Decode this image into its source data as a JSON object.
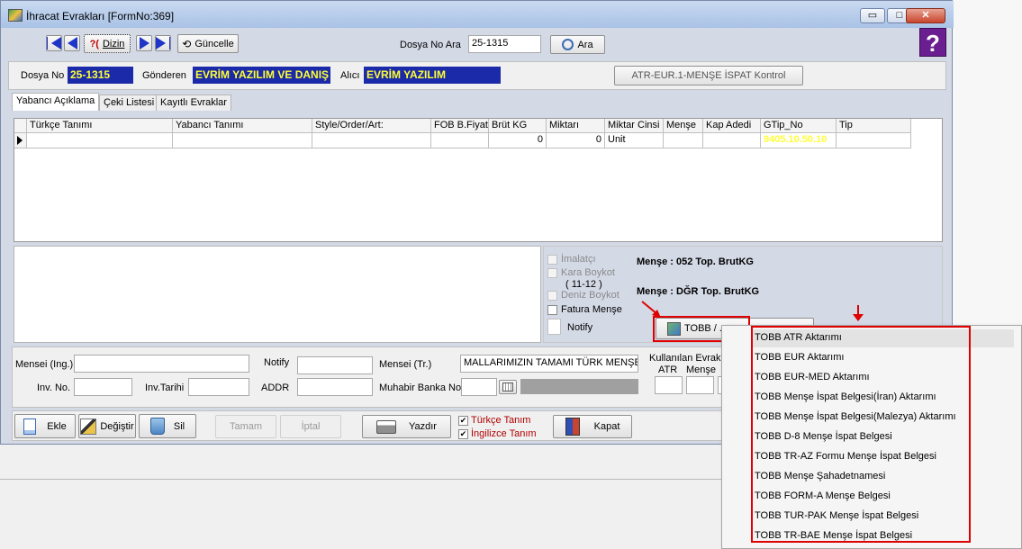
{
  "window": {
    "title": "İhracat Evrakları [FormNo:369]",
    "min": "▭",
    "max": "□",
    "close": "✕"
  },
  "toolbar": {
    "dizin_label": "Dizin",
    "dizin_prefix": "?(",
    "guncelle_label": "Güncelle",
    "dosya_no_ara_label": "Dosya No Ara",
    "dosya_no_ara_value": "25-1315",
    "ara_label": "Ara",
    "help_label": "?"
  },
  "header": {
    "dosya_no_label": "Dosya No",
    "dosya_no_value": "25-1315",
    "gonderen_label": "Gönderen",
    "gonderen_value": "EVRİM YAZILIM VE DANIŞ",
    "alici_label": "Alıcı",
    "alici_value": "EVRİM YAZILIM",
    "atr_button": "ATR-EUR.1-MENŞE İSPAT Kontrol"
  },
  "tabs": [
    {
      "label": "Yabancı Açıklama"
    },
    {
      "label": "Çeki Listesi"
    },
    {
      "label": "Kayıtlı Evraklar"
    }
  ],
  "grid": {
    "columns": [
      "Türkçe Tanımı",
      "Yabancı Tanımı",
      "Style/Order/Art:",
      "FOB B.Fiyatı",
      "Brüt KG",
      "Miktarı",
      "Miktar Cinsi",
      "Menşe",
      "Kap Adedi",
      "GTip_No",
      "Tip"
    ],
    "row": [
      "",
      "",
      "",
      "",
      "0",
      "0",
      "Unit",
      "",
      "",
      "9405.10.50.10",
      ""
    ]
  },
  "checks": {
    "imalatci": "İmalatçı",
    "kara_boykot": "Kara Boykot",
    "kara_boykot_sub": "( 11-12 )",
    "deniz_boykot": "Deniz Boykot",
    "fatura_mense": "Fatura Menşe",
    "notify": "Notify"
  },
  "info": {
    "line1": "Menşe : 052  Top. BrutKG",
    "line2": "Menşe : DĞR  Top. BrutKG"
  },
  "tobb_button": "TOBB / ...",
  "lower": {
    "mensei_ing": "Mensei (Ing.)",
    "notify": "Notify",
    "mensei_tr": "Mensei (Tr.)",
    "mensei_tr_value": "MALLARIMIZIN TAMAMI TÜRK MENŞE",
    "inv_no": "Inv. No.",
    "inv_tarihi": "Inv.Tarihi",
    "addr": "ADDR",
    "muhabir": "Muhabir Banka No",
    "kullanilan": "Kullanılan Evrak",
    "atr": "ATR",
    "mense": "Menşe"
  },
  "bottom": {
    "ekle": "Ekle",
    "degistir": "Değiştir",
    "sil": "Sil",
    "tamam": "Tamam",
    "iptal": "İptal",
    "yazdir": "Yazdır",
    "turkce_tanim": "Türkçe Tanım",
    "ingilizce_tanim": "İngilizce Tanım",
    "kapat": "Kapat"
  },
  "menu": [
    "TOBB ATR Aktarımı",
    "TOBB EUR Aktarımı",
    "TOBB EUR-MED Aktarımı",
    "TOBB Menşe İspat Belgesi(İran) Aktarımı",
    "TOBB Menşe İspat Belgesi(Malezya) Aktarımı",
    "TOBB D-8 Menşe İspat Belgesi",
    "TOBB TR-AZ Formu Menşe İspat Belgesi",
    "TOBB Menşe Şahadetnamesi",
    "TOBB FORM-A Menşe Belgesi",
    "TOBB TUR-PAK Menşe İspat Belgesi",
    "TOBB TR-BAE Menşe İspat Belgesi"
  ],
  "colors": {
    "highlight_bg": "#1b2aa8",
    "highlight_fg": "#ffff33",
    "annotation": "#e00000"
  }
}
